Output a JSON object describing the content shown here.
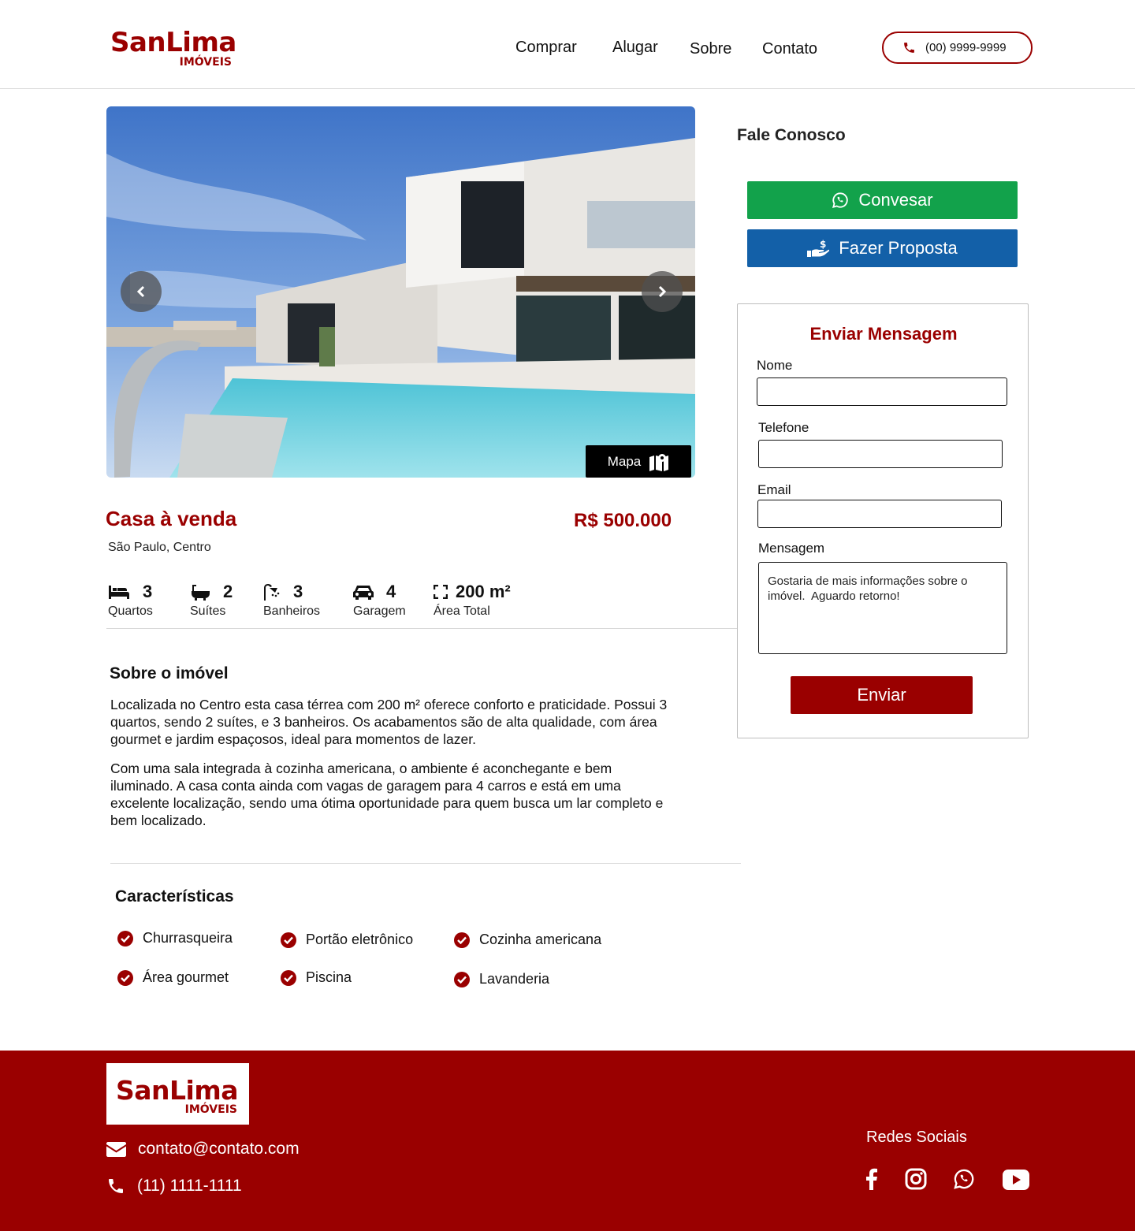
{
  "header": {
    "logo_brand": "SanLima",
    "logo_sub": "IMÓVEIS",
    "nav": [
      "Comprar",
      "Alugar",
      "Sobre",
      "Contato"
    ],
    "phone": "(00) 9999-9999"
  },
  "hero": {
    "map_button": "Mapa"
  },
  "listing": {
    "title": "Casa à venda",
    "price": "R$ 500.000",
    "location": "São Paulo, Centro",
    "features": [
      {
        "icon": "bed-icon",
        "value": "3",
        "label": "Quartos"
      },
      {
        "icon": "bathtub-icon",
        "value": "2",
        "label": "Suítes"
      },
      {
        "icon": "shower-icon",
        "value": "3",
        "label": "Banheiros"
      },
      {
        "icon": "car-icon",
        "value": "4",
        "label": "Garagem"
      },
      {
        "icon": "expand-icon",
        "value": "200 m²",
        "label": "Área Total"
      }
    ],
    "about_title": "Sobre o imóvel",
    "about_p1": "Localizada no Centro esta casa térrea com 200 m² oferece conforto e praticidade. Possui 3 quartos, sendo 2 suítes, e 3 banheiros. Os acabamentos são de alta qualidade, com área gourmet e jardim espaçosos, ideal para momentos de lazer.",
    "about_p2": "Com uma sala integrada à cozinha americana, o ambiente é aconchegante e bem iluminado. A casa conta ainda com vagas de garagem para 4 carros e está em uma excelente localização, sendo uma ótima oportunidade para quem busca um lar completo e bem localizado.",
    "features_title": "Características",
    "characteristics": [
      "Churrasqueira",
      "Portão eletrônico",
      "Cozinha americana",
      "Área gourmet",
      "Piscina",
      "Lavanderia"
    ]
  },
  "sidebar": {
    "title": "Fale Conosco",
    "chat_button": "Convesar",
    "offer_button": "Fazer Proposta",
    "form_title": "Enviar Mensagem",
    "name_label": "Nome",
    "phone_label": "Telefone",
    "email_label": "Email",
    "message_label": "Mensagem",
    "message_value": "Gostaria de mais informações sobre o imóvel.  Aguardo retorno!",
    "send_button": "Enviar"
  },
  "footer": {
    "logo_brand": "SanLima",
    "logo_sub": "IMÓVEIS",
    "email": "contato@contato.com",
    "phone": "(11) 1111-1111",
    "social_title": "Redes Sociais",
    "social_icons": [
      "facebook-icon",
      "instagram-icon",
      "whatsapp-icon",
      "youtube-icon"
    ]
  },
  "colors": {
    "brand": "#9a0000",
    "whatsapp_green": "#12a24b",
    "proposal_blue": "#1360a8"
  }
}
